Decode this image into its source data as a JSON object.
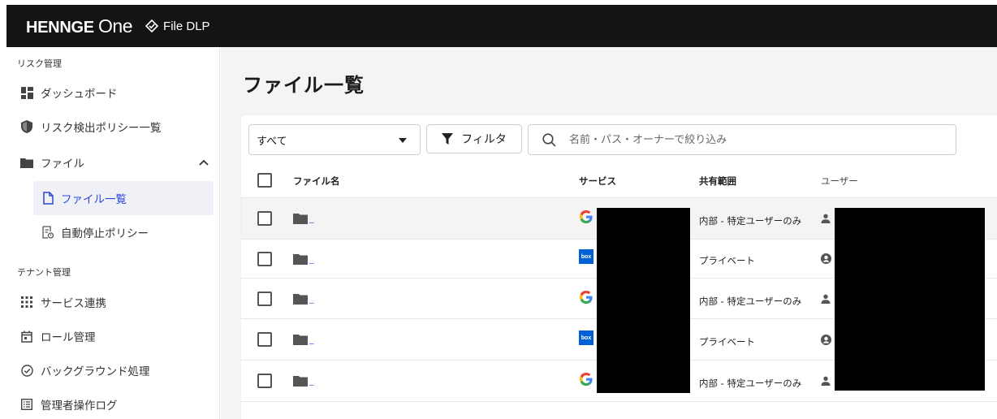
{
  "header": {
    "brand_bold": "HENNGE",
    "brand_light": "One",
    "product": "File DLP"
  },
  "sidebar": {
    "sections": [
      {
        "title": "リスク管理",
        "items": [
          {
            "label": "ダッシュボード",
            "icon": "dashboard-icon"
          },
          {
            "label": "リスク検出ポリシー一覧",
            "icon": "shield-icon"
          },
          {
            "label": "ファイル",
            "icon": "folder-icon",
            "expanded": true,
            "children": [
              {
                "label": "ファイル一覧",
                "icon": "file-icon",
                "active": true
              },
              {
                "label": "自動停止ポリシー",
                "icon": "policy-doc-icon"
              }
            ]
          }
        ]
      },
      {
        "title": "テナント管理",
        "items": [
          {
            "label": "サービス連携",
            "icon": "grid-icon"
          },
          {
            "label": "ロール管理",
            "icon": "calendar-icon"
          },
          {
            "label": "バックグラウンド処理",
            "icon": "check-circle-icon"
          },
          {
            "label": "管理者操作ログ",
            "icon": "list-icon"
          }
        ]
      }
    ]
  },
  "main": {
    "title": "ファイル一覧",
    "toolbar": {
      "select_value": "すべて",
      "filter_label": "フィルタ",
      "search_placeholder": "名前・パス・オーナーで絞り込み"
    },
    "table": {
      "columns": [
        "ファイル名",
        "サービス",
        "共有範囲",
        "ユーザー"
      ],
      "rows": [
        {
          "name": "_",
          "service": "google-drive",
          "scope": "内部 - 特定ユーザーのみ",
          "user_icon": "person-icon",
          "highlighted": true
        },
        {
          "name": "_",
          "service": "box",
          "service_label": "box",
          "scope": "プライベート",
          "user_icon": "account-circle-icon",
          "highlighted": false
        },
        {
          "name": "_",
          "service": "google-drive",
          "scope": "内部 - 特定ユーザーのみ",
          "user_icon": "person-icon",
          "highlighted": false
        },
        {
          "name": "_",
          "service": "box",
          "service_label": "box",
          "scope": "プライベート",
          "user_icon": "account-circle-icon",
          "highlighted": false
        },
        {
          "name": "_",
          "service": "google-drive",
          "scope": "内部 - 特定ユーザーのみ",
          "user_icon": "person-icon",
          "highlighted": false
        }
      ]
    }
  },
  "colors": {
    "topbar": "#141414",
    "accent": "#2c48d9",
    "box_blue": "#0061d5",
    "active_bg": "#f0f1f7"
  }
}
